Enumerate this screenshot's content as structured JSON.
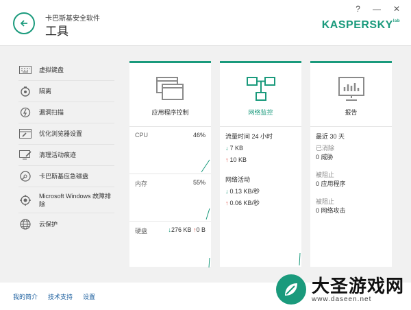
{
  "header": {
    "app_name": "卡巴斯基安全软件",
    "title": "工具",
    "help": "?",
    "minimize": "—",
    "close": "✕",
    "logo": "KASPERSKY",
    "logo_suffix": "lab"
  },
  "sidebar": {
    "items": [
      {
        "label": "虚拟键盘",
        "icon": "keyboard-icon"
      },
      {
        "label": "隔离",
        "icon": "quarantine-icon"
      },
      {
        "label": "漏洞扫描",
        "icon": "vulnerability-scan-icon"
      },
      {
        "label": "优化浏览器设置",
        "icon": "browser-settings-icon"
      },
      {
        "label": "清理活动痕迹",
        "icon": "privacy-cleaner-icon"
      },
      {
        "label": "卡巴斯基应急磁盘",
        "icon": "rescue-disk-icon"
      },
      {
        "label": "Microsoft Windows 故障排除",
        "icon": "troubleshoot-icon"
      },
      {
        "label": "云保护",
        "icon": "cloud-protection-icon"
      }
    ]
  },
  "cards": {
    "app_control": {
      "title": "应用程序控制",
      "cpu_label": "CPU",
      "cpu_value": "46%",
      "memory_label": "内存",
      "memory_value": "55%",
      "disk_label": "硬盘",
      "disk_read": "276 KB",
      "disk_write": "0 B"
    },
    "network_monitor": {
      "title": "网络监控",
      "traffic_label": "流量时间 24 小时",
      "traffic_down": "7 KB",
      "traffic_up": "10 KB",
      "activity_label": "网络活动",
      "activity_down": "0.13 KB/秒",
      "activity_up": "0.06 KB/秒"
    },
    "reports": {
      "title": "报告",
      "period": "最近 30 天",
      "removed_label": "已消除",
      "removed_value": "0 威胁",
      "blocked_apps_label": "被阻止",
      "blocked_apps_value": "0 应用程序",
      "blocked_attacks_label": "被阻止",
      "blocked_attacks_value": "0 网络攻击"
    }
  },
  "footer": {
    "profile": "我的简介",
    "support": "技术支持",
    "settings": "设置"
  },
  "watermark": {
    "title": "大圣游戏网",
    "url": "www.daseen.net"
  },
  "colors": {
    "accent": "#1a9a7c",
    "upload": "#e0463a",
    "link": "#1a5e9e"
  }
}
